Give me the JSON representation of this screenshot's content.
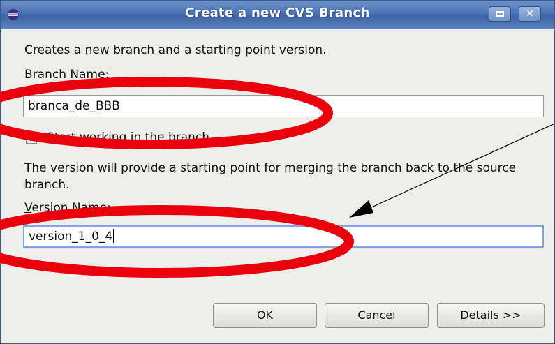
{
  "window": {
    "title": "Create a new CVS Branch"
  },
  "dialog": {
    "intro": "Creates a new branch and a starting point version.",
    "branch_label": "Branch Name:",
    "branch_value": "branca_de_BBB",
    "checkbox_prefix": "Start ",
    "checkbox_mnemonic": "w",
    "checkbox_suffix": "orking in the branch",
    "checkbox_checked": true,
    "description": "The version will provide a starting point for merging the branch back to the source branch.",
    "version_label_mnemonic": "V",
    "version_label_rest": "ersion Name:",
    "version_value": "version_1_0_4"
  },
  "buttons": {
    "ok": "OK",
    "cancel": "Cancel",
    "details_mnemonic": "D",
    "details_rest": "etails >>"
  },
  "annotations": {
    "ellipse_color": "#e8000b",
    "arrow_color": "#000000"
  }
}
